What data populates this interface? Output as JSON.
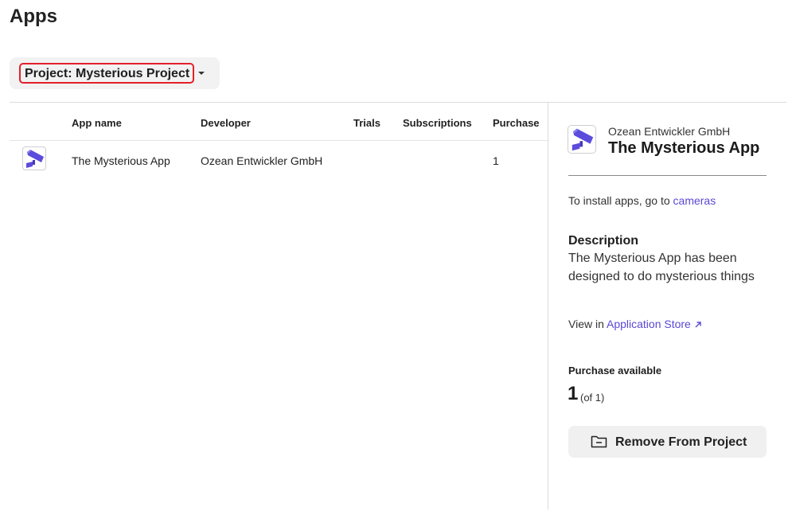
{
  "page": {
    "title": "Apps"
  },
  "project_selector": {
    "label": "Project: Mysterious Project"
  },
  "table": {
    "headers": [
      "App name",
      "Developer",
      "Trials",
      "Subscriptions",
      "Purchase"
    ],
    "rows": [
      {
        "icon": "camera-icon",
        "app_name": "The Mysterious App",
        "developer": "Ozean Entwickler GmbH",
        "trials": "",
        "subscriptions": "",
        "purchase": "1"
      }
    ]
  },
  "detail": {
    "icon": "camera-icon",
    "developer": "Ozean Entwickler GmbH",
    "title": "The Mysterious App",
    "install_prefix": "To install apps, go to ",
    "install_link": "cameras",
    "description_heading": "Description",
    "description_text": "The Mysterious App has been designed to do mysterious things",
    "view_prefix": "View in ",
    "view_link": "Application Store",
    "view_link_icon": "external-link-arrow-icon",
    "purchase_heading": "Purchase available",
    "purchase_count": "1",
    "purchase_total": "(of 1)",
    "remove_button": "Remove From Project",
    "remove_icon": "folder-minus-icon"
  },
  "colors": {
    "accent": "#5a48d6",
    "highlight": "#e3202a",
    "icon": "#5b4cdc"
  }
}
